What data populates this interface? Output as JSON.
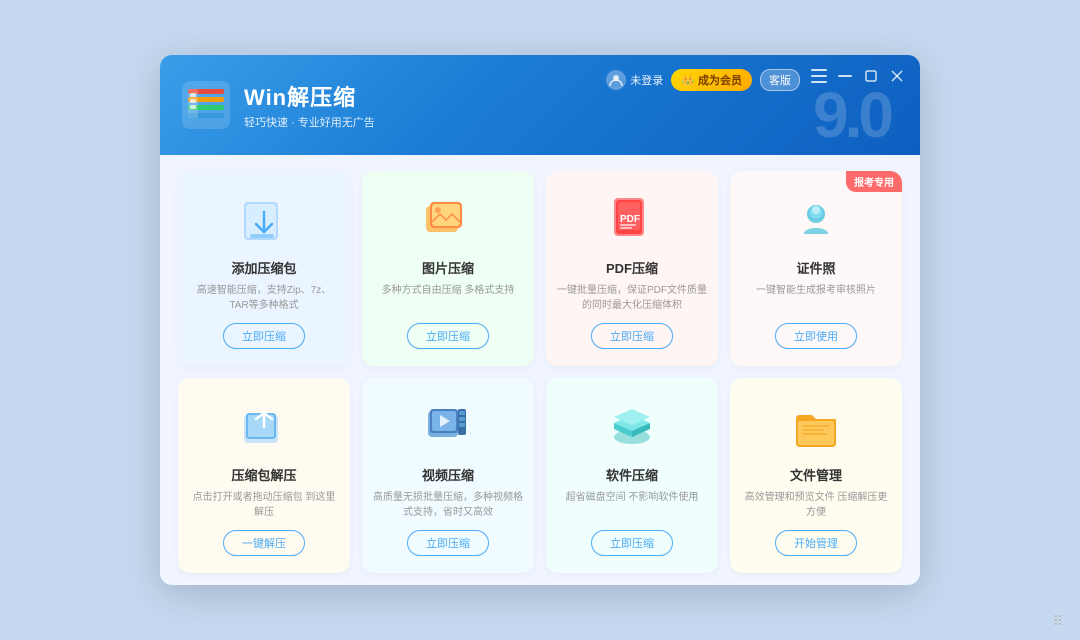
{
  "window": {
    "title": "Win解压缩",
    "subtitle": "轻巧快速 · 专业好用无广告",
    "version": "9.0"
  },
  "header": {
    "login_text": "未登录",
    "vip_label": "成为会员",
    "guest_label": "客版",
    "menu_icon": "menu-icon",
    "minimize_icon": "minimize-icon",
    "maximize_icon": "maximize-icon",
    "close_icon": "close-icon"
  },
  "cards": [
    {
      "id": "add-zip",
      "title": "添加压缩包",
      "desc": "高速智能压缩，支持Zip、7z、TAR等多种格式",
      "btn": "立即压缩",
      "bg": "card-blue",
      "badge": null,
      "icon_type": "download-box"
    },
    {
      "id": "image-compress",
      "title": "图片压缩",
      "desc": "多种方式自由压缩 多格式支持",
      "btn": "立即压缩",
      "bg": "card-green",
      "badge": null,
      "icon_type": "image-stack"
    },
    {
      "id": "pdf-compress",
      "title": "PDF压缩",
      "desc": "一键批量压缩，保证PDF文件质量的同时最大化压缩体积",
      "btn": "立即压缩",
      "bg": "card-red",
      "badge": null,
      "icon_type": "pdf-file"
    },
    {
      "id": "id-photo",
      "title": "证件照",
      "desc": "一键智能生成报考审核照片",
      "btn": "立即使用",
      "bg": "card-pink",
      "badge": "报考专用",
      "icon_type": "person-card"
    },
    {
      "id": "extract-zip",
      "title": "压缩包解压",
      "desc": "点击打开或者拖动压缩包 到这里解压",
      "btn": "一键解压",
      "bg": "card-orange",
      "badge": null,
      "icon_type": "upload-box"
    },
    {
      "id": "video-compress",
      "title": "视频压缩",
      "desc": "高质量无损批量压缩，多种视频格式支持，省时又高效",
      "btn": "立即压缩",
      "bg": "card-teal",
      "badge": null,
      "icon_type": "video-box"
    },
    {
      "id": "software-compress",
      "title": "软件压缩",
      "desc": "超省磁盘空间 不影响软件使用",
      "btn": "立即压缩",
      "bg": "card-cyan",
      "badge": null,
      "icon_type": "layers"
    },
    {
      "id": "file-manage",
      "title": "文件管理",
      "desc": "高效管理和预览文件 压缩解压更方便",
      "btn": "开始管理",
      "bg": "card-yellow",
      "badge": null,
      "icon_type": "folder"
    }
  ]
}
